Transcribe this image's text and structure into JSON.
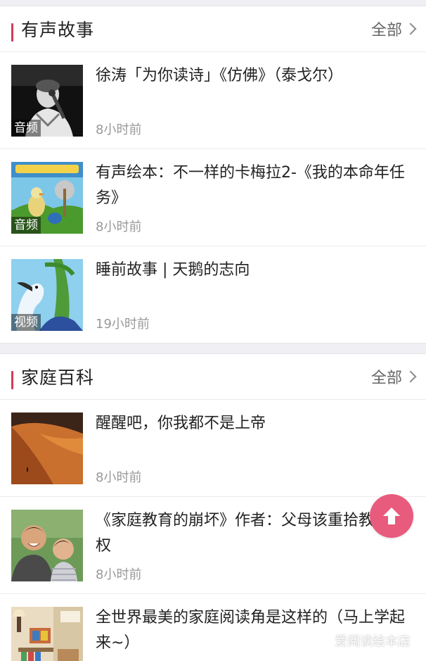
{
  "sections": [
    {
      "title": "有声故事",
      "more_label": "全部",
      "items": [
        {
          "title": "徐涛「为你读诗」《仿佛》（泰戈尔）",
          "time": "8小时前",
          "tag": "音频",
          "thumb": "man-with-microphone"
        },
        {
          "title": "有声绘本：不一样的卡梅拉2-《我的本命年任务》",
          "time": "8小时前",
          "tag": "音频",
          "thumb": "picture-book-cover"
        },
        {
          "title": "睡前故事 | 天鹅的志向",
          "time": "19小时前",
          "tag": "视频",
          "thumb": "cartoon-swan"
        }
      ]
    },
    {
      "title": "家庭百科",
      "more_label": "全部",
      "items": [
        {
          "title": "醒醒吧，你我都不是上帝",
          "time": "8小时前",
          "tag": "",
          "thumb": "desert-dune"
        },
        {
          "title": "《家庭教育的崩坏》作者：父母该重拾教养主权",
          "time": "8小时前",
          "tag": "",
          "thumb": "father-and-son"
        },
        {
          "title": "全世界最美的家庭阅读角是这样的（马上学起来~）",
          "time": "",
          "tag": "",
          "thumb": "reading-corner"
        }
      ]
    }
  ],
  "watermark": {
    "text": "爱阅读绘本店",
    "icon": "wechat-icon"
  },
  "colors": {
    "accent": "#d23a57",
    "fab": "#e85b7d",
    "background": "#efeff4",
    "time_text": "#999999"
  },
  "icons": {
    "back_to_top": "arrow-up-icon",
    "more": "chevron-right-icon"
  }
}
